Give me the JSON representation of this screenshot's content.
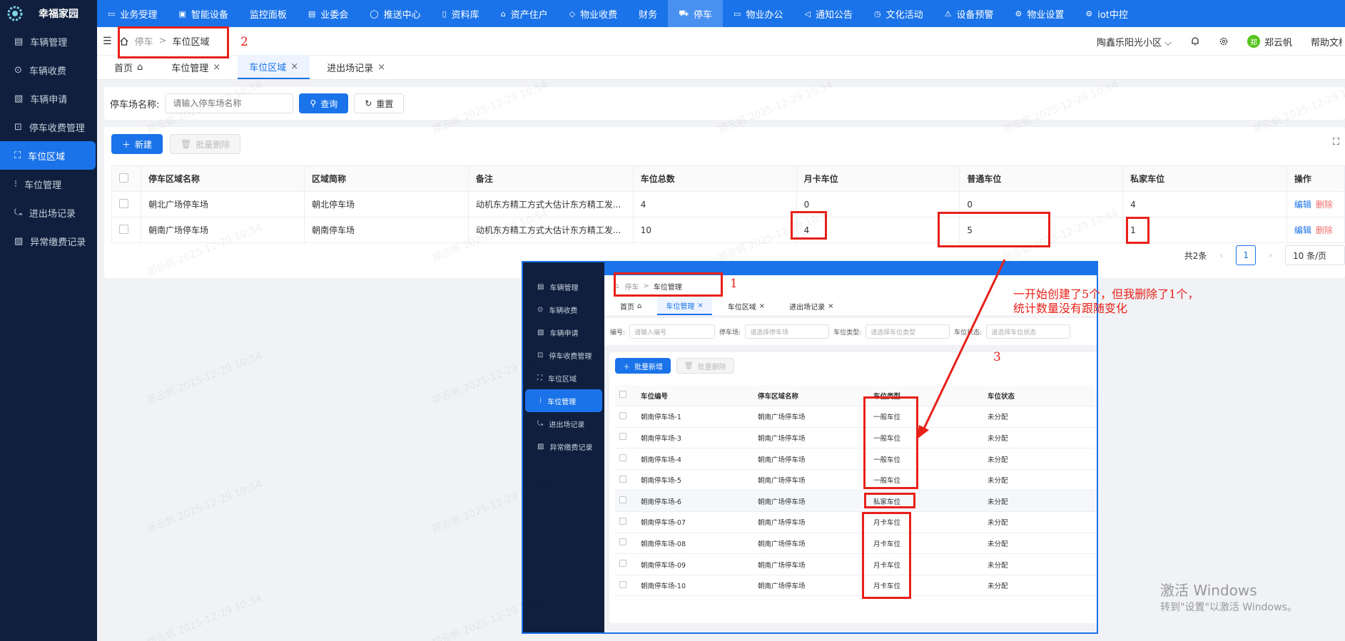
{
  "app": {
    "name": "幸福家园"
  },
  "top_nav": [
    {
      "label": "业务受理",
      "icon": "monitor-icon"
    },
    {
      "label": "智能设备",
      "icon": "device-icon"
    },
    {
      "label": "监控面板",
      "icon": ""
    },
    {
      "label": "业委会",
      "icon": "document-icon"
    },
    {
      "label": "推送中心",
      "icon": "chat-icon"
    },
    {
      "label": "资料库",
      "icon": "file-icon"
    },
    {
      "label": "资产住户",
      "icon": "home-icon"
    },
    {
      "label": "物业收费",
      "icon": "shield-icon"
    },
    {
      "label": "财务",
      "icon": ""
    },
    {
      "label": "停车",
      "icon": "car-icon",
      "active": true
    },
    {
      "label": "物业办公",
      "icon": "laptop-icon"
    },
    {
      "label": "通知公告",
      "icon": "megaphone-icon"
    },
    {
      "label": "文化活动",
      "icon": "clock-icon"
    },
    {
      "label": "设备预警",
      "icon": "alarm-icon"
    },
    {
      "label": "物业设置",
      "icon": "gear-icon"
    },
    {
      "label": "iot中控",
      "icon": "gear-icon"
    }
  ],
  "sidebar": [
    {
      "label": "车辆管理"
    },
    {
      "label": "车辆收费"
    },
    {
      "label": "车辆申请"
    },
    {
      "label": "停车收费管理"
    },
    {
      "label": "车位区域",
      "active": true
    },
    {
      "label": "车位管理"
    },
    {
      "label": "进出场记录"
    },
    {
      "label": "异常缴费记录"
    }
  ],
  "breadcrumb": {
    "parent": "停车",
    "sep": ">",
    "current": "车位区域"
  },
  "header": {
    "community": "陶鑫乐阳光小区",
    "user": "郑云帆",
    "user_avatar_char": "郑",
    "help": "帮助文档"
  },
  "tabs": [
    {
      "label": "首页",
      "closable": false
    },
    {
      "label": "车位管理",
      "closable": true
    },
    {
      "label": "车位区域",
      "closable": true,
      "active": true
    },
    {
      "label": "进出场记录",
      "closable": true
    }
  ],
  "search": {
    "label": "停车场名称:",
    "placeholder": "请输入停车场名称",
    "query": "查询",
    "reset": "重置"
  },
  "toolbar": {
    "new": "新建",
    "batch_delete": "批量删除"
  },
  "table": {
    "headers": [
      "停车区域名称",
      "区域简称",
      "备注",
      "车位总数",
      "月卡车位",
      "普通车位",
      "私家车位",
      "操作"
    ],
    "rows": [
      [
        "朝北广场停车场",
        "朝北停车场",
        "动机东方精工方式大估计东方精工发...",
        "4",
        "0",
        "0",
        "4"
      ],
      [
        "朝南广场停车场",
        "朝南停车场",
        "动机东方精工方式大估计东方精工发...",
        "10",
        "4",
        "5",
        "1"
      ]
    ],
    "edit": "编辑",
    "delete": "删除"
  },
  "pagination": {
    "total": "共2条",
    "page": "1",
    "size": "10 条/页"
  },
  "annotations": {
    "num1": "1",
    "num2": "2",
    "num3": "3",
    "note_line1": "一开始创建了5个，但我删除了1个，",
    "note_line2": "统计数量没有跟随变化"
  },
  "inset": {
    "breadcrumb": {
      "parent": "停车",
      "current": "车位管理"
    },
    "tabs": [
      "首页",
      "车位管理",
      "车位区域",
      "进出场记录"
    ],
    "filters": [
      {
        "label": "编号:",
        "placeholder": "请输入编号"
      },
      {
        "label": "停车场:",
        "placeholder": "请选择停车场"
      },
      {
        "label": "车位类型:",
        "placeholder": "请选择车位类型"
      },
      {
        "label": "车位状态:",
        "placeholder": "请选择车位状态"
      }
    ],
    "batch_add": "批量新增",
    "batch_delete": "批量删除",
    "headers": [
      "车位编号",
      "停车区域名称",
      "车位类型",
      "车位状态"
    ],
    "rows": [
      [
        "朝南停车场-1",
        "朝南广场停车场",
        "一般车位",
        "未分配"
      ],
      [
        "朝南停车场-3",
        "朝南广场停车场",
        "一般车位",
        "未分配"
      ],
      [
        "朝南停车场-4",
        "朝南广场停车场",
        "一般车位",
        "未分配"
      ],
      [
        "朝南停车场-5",
        "朝南广场停车场",
        "一般车位",
        "未分配"
      ],
      [
        "朝南停车场-6",
        "朝南广场停车场",
        "私家车位",
        "未分配"
      ],
      [
        "朝南停车场-07",
        "朝南广场停车场",
        "月卡车位",
        "未分配"
      ],
      [
        "朝南停车场-08",
        "朝南广场停车场",
        "月卡车位",
        "未分配"
      ],
      [
        "朝南停车场-09",
        "朝南广场停车场",
        "月卡车位",
        "未分配"
      ],
      [
        "朝南停车场-10",
        "朝南广场停车场",
        "月卡车位",
        "未分配"
      ]
    ]
  },
  "watermark": "郑云帆 2025-12-29 10:54",
  "windows_activation": {
    "line1": "激活 Windows",
    "line2": "转到\"设置\"以激活 Windows。"
  },
  "colors": {
    "primary": "#1a73e8",
    "sidebar": "#0f1f3d",
    "annotation": "#e8201a"
  }
}
